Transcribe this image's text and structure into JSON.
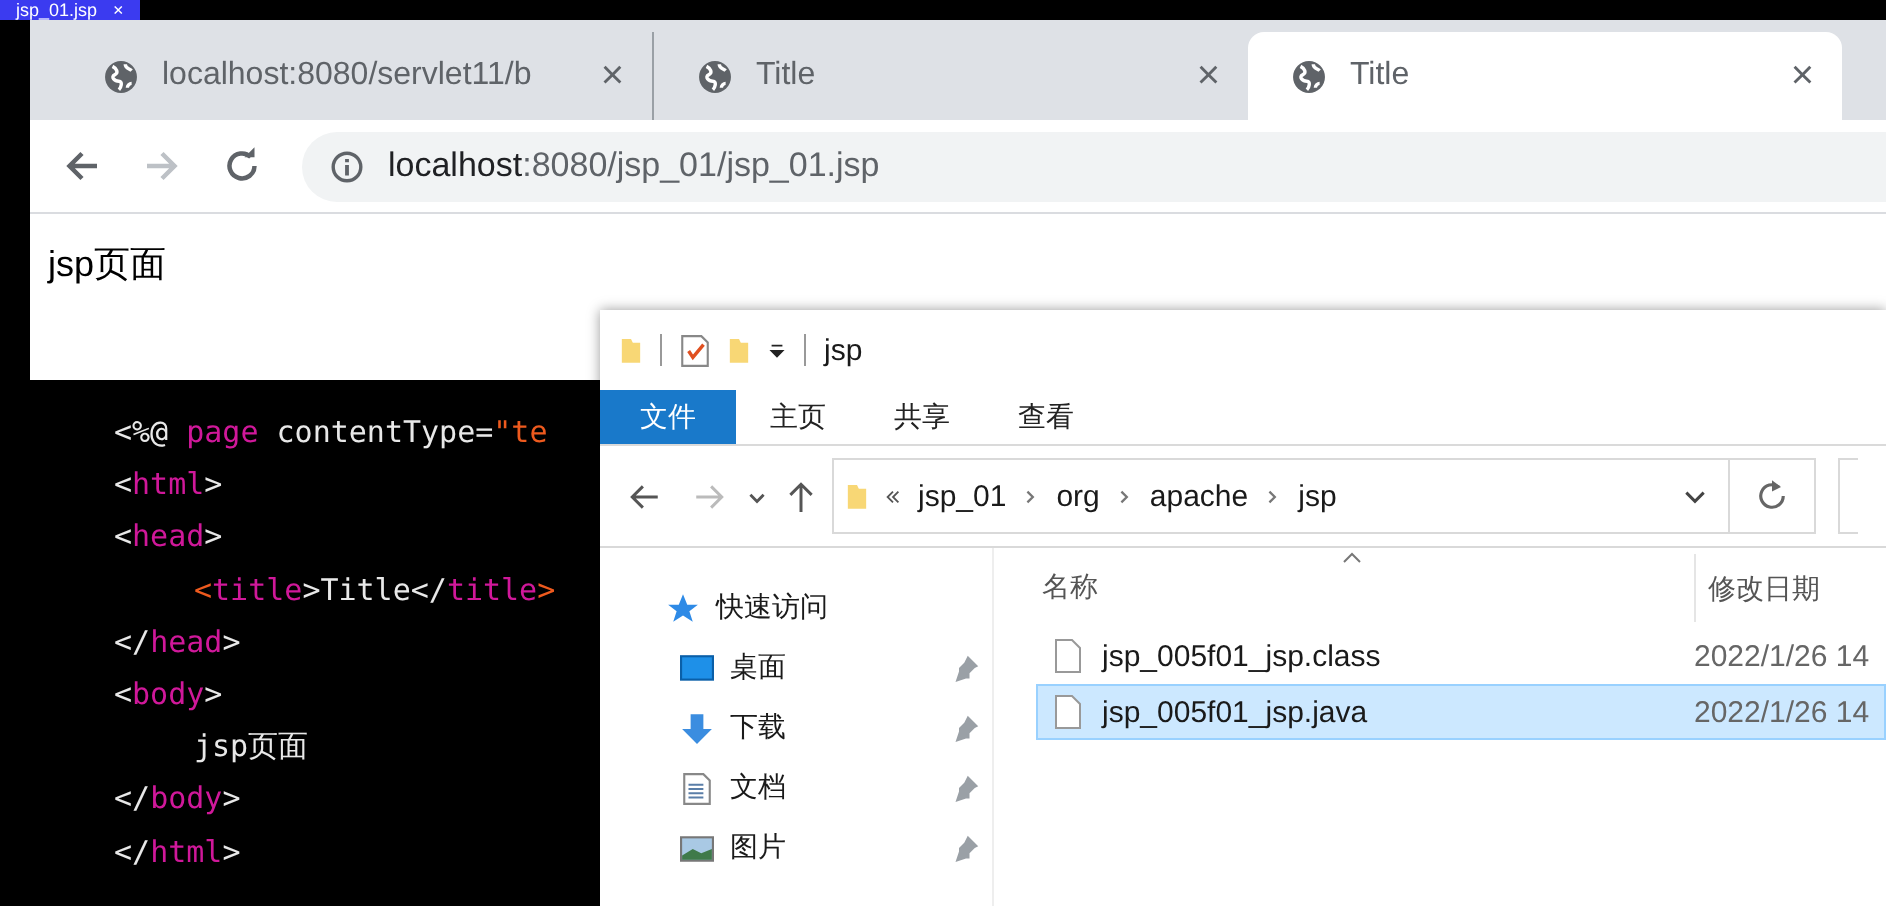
{
  "editor": {
    "tab": {
      "label": "jsp_01.jsp",
      "close": "×"
    },
    "code_lines": [
      [
        {
          "text": "<%@ ",
          "kind": "punct"
        },
        {
          "text": "page",
          "kind": "tag"
        },
        {
          "text": " contentType=",
          "kind": "plain"
        },
        {
          "text": "\"te",
          "kind": "string"
        }
      ],
      [
        {
          "text": "<",
          "kind": "punct"
        },
        {
          "text": "html",
          "kind": "tag"
        },
        {
          "text": ">",
          "kind": "punct"
        }
      ],
      [
        {
          "text": "<",
          "kind": "punct"
        },
        {
          "text": "head",
          "kind": "tag"
        },
        {
          "text": ">",
          "kind": "punct"
        }
      ],
      [
        {
          "text": "<",
          "kind": "string"
        },
        {
          "text": "title",
          "kind": "tag"
        },
        {
          "text": ">Title</",
          "kind": "plain"
        },
        {
          "text": "title",
          "kind": "tag"
        },
        {
          "text": ">",
          "kind": "string"
        }
      ],
      [
        {
          "text": "</",
          "kind": "punct"
        },
        {
          "text": "head",
          "kind": "tag"
        },
        {
          "text": ">",
          "kind": "punct"
        }
      ],
      [
        {
          "text": "<",
          "kind": "punct"
        },
        {
          "text": "body",
          "kind": "tag"
        },
        {
          "text": ">",
          "kind": "punct"
        }
      ],
      [
        {
          "text": "jsp页面",
          "kind": "plain"
        }
      ],
      [
        {
          "text": "</",
          "kind": "punct"
        },
        {
          "text": "body",
          "kind": "tag"
        },
        {
          "text": ">",
          "kind": "punct"
        }
      ],
      [
        {
          "text": "</",
          "kind": "punct"
        },
        {
          "text": "html",
          "kind": "tag"
        },
        {
          "text": ">",
          "kind": "punct"
        }
      ]
    ]
  },
  "browser": {
    "tabs": [
      {
        "title": "localhost:8080/servlet11/b",
        "close": "×",
        "selected": false
      },
      {
        "title": "Title",
        "close": "×",
        "selected": false
      },
      {
        "title": "Title",
        "close": "×",
        "selected": true
      }
    ],
    "forward_disabled": true,
    "url_host": "localhost",
    "url_path": ":8080/jsp_01/jsp_01.jsp",
    "content": "jsp页面"
  },
  "explorer": {
    "title": "jsp",
    "ribbon_tabs": [
      {
        "label": "文件",
        "selected": true
      },
      {
        "label": "主页",
        "selected": false
      },
      {
        "label": "共享",
        "selected": false
      },
      {
        "label": "查看",
        "selected": false
      }
    ],
    "breadcrumb": [
      "jsp_01",
      "org",
      "apache",
      "jsp"
    ],
    "nav": [
      {
        "label": "快速访问",
        "kind": "star",
        "pinned": false
      },
      {
        "label": "桌面",
        "kind": "desktop",
        "pinned": true
      },
      {
        "label": "下载",
        "kind": "download",
        "pinned": true
      },
      {
        "label": "文档",
        "kind": "document",
        "pinned": true
      },
      {
        "label": "图片",
        "kind": "picture",
        "pinned": true
      }
    ],
    "columns": [
      "名称",
      "修改日期"
    ],
    "files": [
      {
        "name": "jsp_005f01_jsp.class",
        "date": "2022/1/26 14",
        "selected": false
      },
      {
        "name": "jsp_005f01_jsp.java",
        "date": "2022/1/26 14",
        "selected": true
      }
    ]
  }
}
